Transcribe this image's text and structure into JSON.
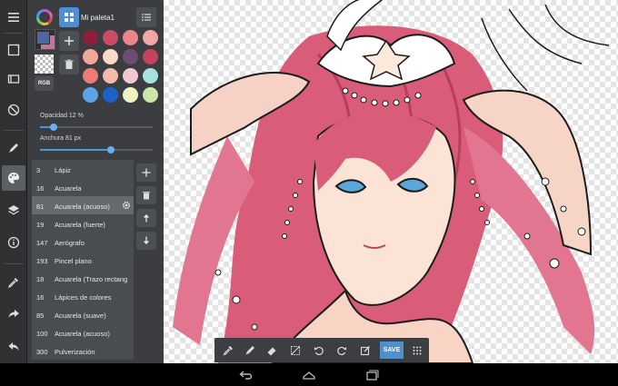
{
  "palette": {
    "name": "Mi paleta1",
    "swatches": [
      "#8e1f3b",
      "#cd4a63",
      "#ec8489",
      "#f4a7a1",
      "#f3a69a",
      "#fcd9c6",
      "#6f4b70",
      "#c6435c",
      "#ee7b7a",
      "#f5bba9",
      "#f2c6d2",
      "#a7e2de",
      "#5aa4e5",
      "#1d63c6",
      "#f0f2c2",
      "#cce6a9"
    ],
    "primary_color": "#4f66a6",
    "secondary_color": "#cd6fa0"
  },
  "color_mode_label": "RGB",
  "sliders": {
    "opacity_label": "Opacidad 12 %",
    "opacity_value": 12,
    "width_label": "Anchura 81 px",
    "width_fraction": 0.63
  },
  "brushes": [
    {
      "size": "3",
      "name": "Lápiz"
    },
    {
      "size": "16",
      "name": "Acuarela"
    },
    {
      "size": "81",
      "name": "Acuarela (acuoso)"
    },
    {
      "size": "19",
      "name": "Acuarela (fuerte)"
    },
    {
      "size": "147",
      "name": "Aerógrafo"
    },
    {
      "size": "193",
      "name": "Pincel plano"
    },
    {
      "size": "18",
      "name": "Acuarela (Trazo rectang..."
    },
    {
      "size": "16",
      "name": "Lápices de colores"
    },
    {
      "size": "85",
      "name": "Acuarela (suave)"
    },
    {
      "size": "100",
      "name": "Acuarela (acuoso)"
    },
    {
      "size": "300",
      "name": "Pulverización"
    }
  ],
  "selected_brush_index": 2,
  "toolbar": {
    "save_label": "SAVE",
    "accent": "#4f8fcb"
  },
  "icons": {
    "rail": [
      "menu-icon",
      "select-icon",
      "eraser-rail-icon",
      "brush-icon",
      "palette-icon",
      "layers-icon",
      "info-icon",
      "eyedropper-icon",
      "share-icon",
      "undo-icon"
    ],
    "toolbar": [
      "eyedropper-icon",
      "pen-icon",
      "eraser-icon",
      "transform-icon",
      "rotate-left-icon",
      "rotate-right-icon",
      "edit-icon",
      "grid-icon"
    ]
  }
}
